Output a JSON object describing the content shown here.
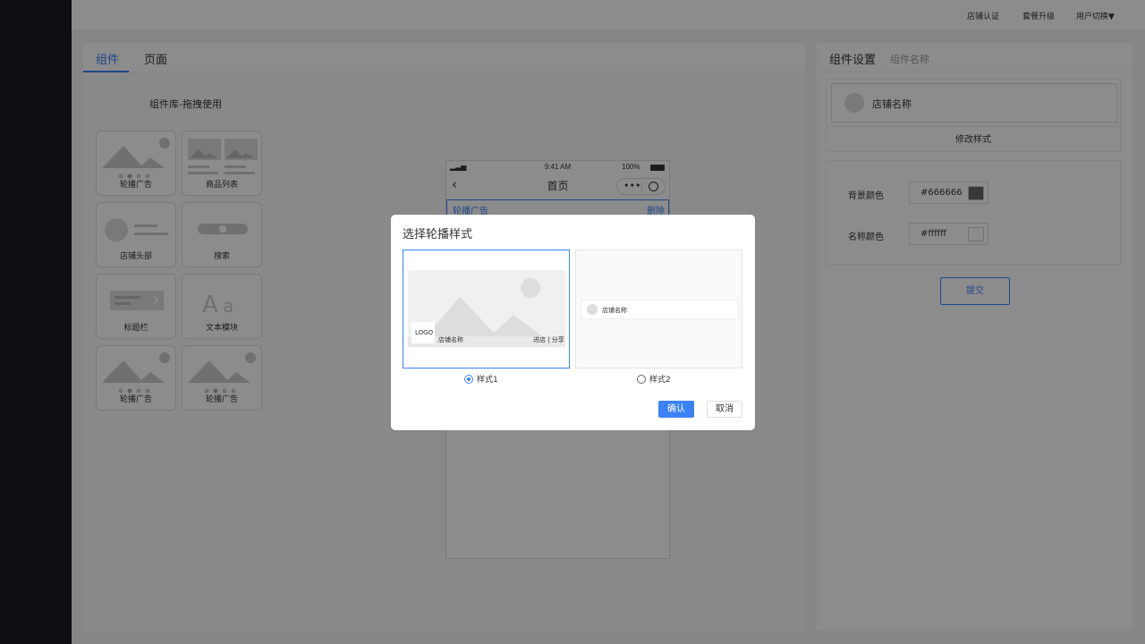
{
  "topbar": {
    "links": [
      "店铺认证",
      "套餐升级",
      "用户切换▼"
    ]
  },
  "left_panel": {
    "tabs": [
      "组件",
      "页面"
    ],
    "library_title": "组件库-拖拽使用",
    "components": [
      "轮播广告",
      "商品列表",
      "店铺头部",
      "搜索",
      "标题栏",
      "文本模块",
      "轮播广告",
      "轮播广告"
    ]
  },
  "phone": {
    "status_time": "9:41 AM",
    "battery": "100%",
    "title": "首页",
    "selected_label": "轮播广告",
    "delete_label": "删除"
  },
  "right_panel": {
    "title": "组件设置",
    "subtitle": "组件名称",
    "store_name": "店铺名称",
    "modify_label": "修改样式",
    "bg_color_label": "背景颜色",
    "bg_color_value": "#666666",
    "name_color_label": "名称颜色",
    "name_color_value": "#ffffff",
    "submit_label": "提交"
  },
  "modal": {
    "title": "选择轮播样式",
    "option1": {
      "logo": "LOGO",
      "store_name": "店铺名称",
      "actions": "进店 | 分享",
      "label": "样式1",
      "selected": true
    },
    "option2": {
      "store_name": "店铺名称",
      "label": "样式2",
      "selected": false
    },
    "confirm_label": "确认",
    "cancel_label": "取消"
  },
  "colors": {
    "accent": "#3b82f6",
    "bg_swatch": "#666666",
    "name_swatch": "#ffffff"
  }
}
